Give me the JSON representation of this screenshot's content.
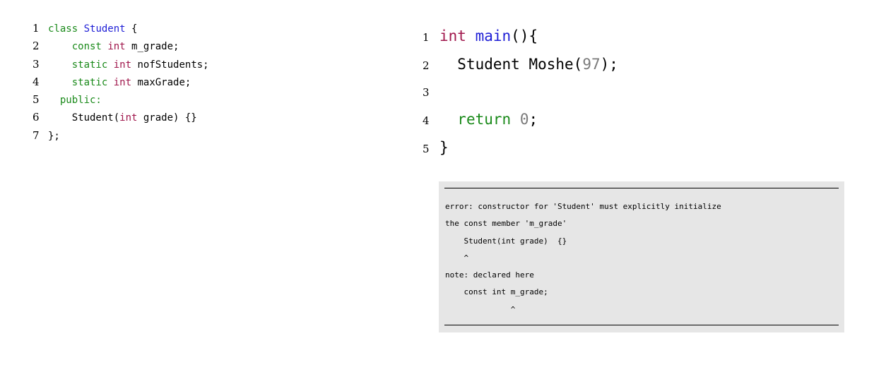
{
  "left_code": {
    "lines": [
      {
        "n": "1",
        "indent": "",
        "tokens": [
          {
            "t": "class",
            "c": "kw-green"
          },
          {
            "t": " ",
            "c": "plain"
          },
          {
            "t": "Student",
            "c": "ident-blue"
          },
          {
            "t": " {",
            "c": "plain"
          }
        ]
      },
      {
        "n": "2",
        "indent": "    ",
        "tokens": [
          {
            "t": "const",
            "c": "kw-green"
          },
          {
            "t": " ",
            "c": "plain"
          },
          {
            "t": "int",
            "c": "kw-magenta"
          },
          {
            "t": " m_grade;",
            "c": "plain"
          }
        ]
      },
      {
        "n": "3",
        "indent": "    ",
        "tokens": [
          {
            "t": "static",
            "c": "kw-green"
          },
          {
            "t": " ",
            "c": "plain"
          },
          {
            "t": "int",
            "c": "kw-magenta"
          },
          {
            "t": " nofStudents;",
            "c": "plain"
          }
        ]
      },
      {
        "n": "4",
        "indent": "    ",
        "tokens": [
          {
            "t": "static",
            "c": "kw-green"
          },
          {
            "t": " ",
            "c": "plain"
          },
          {
            "t": "int",
            "c": "kw-magenta"
          },
          {
            "t": " maxGrade;",
            "c": "plain"
          }
        ]
      },
      {
        "n": "5",
        "indent": "  ",
        "tokens": [
          {
            "t": "public:",
            "c": "kw-green"
          }
        ]
      },
      {
        "n": "6",
        "indent": "    ",
        "tokens": [
          {
            "t": "Student(",
            "c": "plain"
          },
          {
            "t": "int",
            "c": "kw-magenta"
          },
          {
            "t": " grade) {}",
            "c": "plain"
          }
        ]
      },
      {
        "n": "7",
        "indent": "",
        "tokens": [
          {
            "t": "};",
            "c": "plain"
          }
        ]
      }
    ]
  },
  "right_code": {
    "lines": [
      {
        "n": "1",
        "indent": "",
        "tokens": [
          {
            "t": "int",
            "c": "kw-magenta"
          },
          {
            "t": " ",
            "c": "plain"
          },
          {
            "t": "main",
            "c": "ident-blue"
          },
          {
            "t": "(){",
            "c": "plain"
          }
        ]
      },
      {
        "n": "2",
        "indent": "  ",
        "tokens": [
          {
            "t": "Student Moshe(",
            "c": "plain"
          },
          {
            "t": "97",
            "c": "num-gray"
          },
          {
            "t": ");",
            "c": "plain"
          }
        ]
      },
      {
        "n": "3",
        "indent": "",
        "tokens": []
      },
      {
        "n": "4",
        "indent": "  ",
        "tokens": [
          {
            "t": "return",
            "c": "kw-green"
          },
          {
            "t": " ",
            "c": "plain"
          },
          {
            "t": "0",
            "c": "num-gray"
          },
          {
            "t": ";",
            "c": "plain"
          }
        ]
      },
      {
        "n": "5",
        "indent": "",
        "tokens": [
          {
            "t": "}",
            "c": "plain"
          }
        ]
      }
    ]
  },
  "error_output": {
    "lines": [
      "error: constructor for 'Student' must explicitly initialize",
      "the const member 'm_grade'",
      "    Student(int grade)  {}",
      "    ^",
      "note: declared here",
      "    const int m_grade;",
      "              ^"
    ]
  },
  "colors": {
    "keyword_green": "#1a8a1a",
    "type_magenta": "#a0174c",
    "identifier_blue": "#1f1fd6",
    "number_gray": "#7a7a7a",
    "error_background": "#e6e6e6"
  }
}
